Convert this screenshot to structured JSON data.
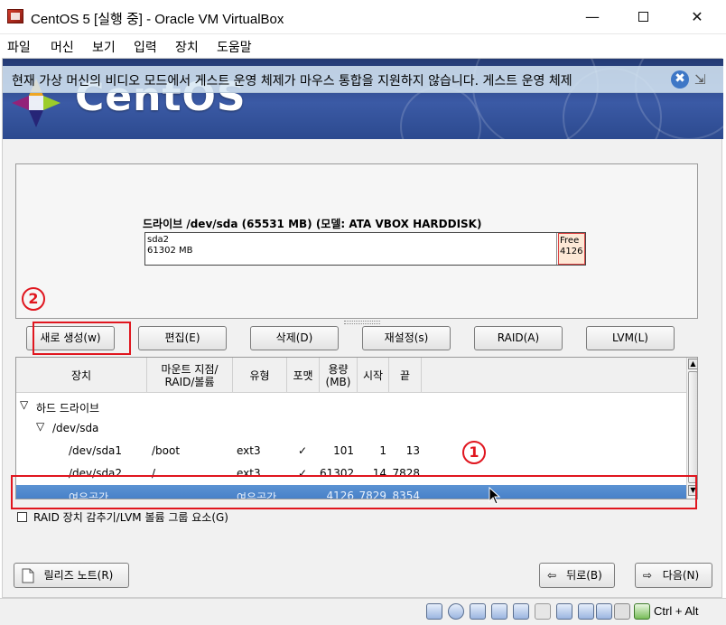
{
  "window": {
    "title": "CentOS 5 [실행 중] - Oracle VM VirtualBox",
    "min_glyph": "—",
    "close_glyph": "✕"
  },
  "menu": [
    "파일",
    "머신",
    "보기",
    "입력",
    "장치",
    "도움말"
  ],
  "banner": {
    "logo_text": "CentOS",
    "notice": "현재 가상 머신의 비디오 모드에서 게스트 운영 체제가 마우스 통합을 지원하지 않습니다. 게스트 운영 체제",
    "notice_close": "✖",
    "notice_arrow": "⇲"
  },
  "disk": {
    "drive_label": "드라이브  /dev/sda (65531 MB) (모델:  ATA VBOX HARDDISK)",
    "seg_main_name": "sda2",
    "seg_main_size": "61302 MB",
    "seg_free_name": "Free",
    "seg_free_size": "4126"
  },
  "buttons": {
    "new": "새로 생성(w)",
    "edit": "편집(E)",
    "delete": "삭제(D)",
    "reset": "재설정(s)",
    "raid": "RAID(A)",
    "lvm": "LVM(L)"
  },
  "annotations": {
    "one": "1",
    "two": "2"
  },
  "table": {
    "headers": {
      "device": "장치",
      "mount": "마운트 지점/ RAID/볼륨",
      "type": "유형",
      "format": "포맷",
      "size": "용량 (MB)",
      "start": "시작",
      "end": "끝"
    },
    "group_hd": "하드 드라이브",
    "group_sda": "/dev/sda",
    "rows": [
      {
        "device": "/dev/sda1",
        "mount": "/boot",
        "type": "ext3",
        "format": "✓",
        "size": "101",
        "start": "1",
        "end": "13"
      },
      {
        "device": "/dev/sda2",
        "mount": "/",
        "type": "ext3",
        "format": "✓",
        "size": "61302",
        "start": "14",
        "end": "7828"
      },
      {
        "device": "여유공간",
        "mount": "",
        "type": "여유공간",
        "format": "",
        "size": "4126",
        "start": "7829",
        "end": "8354"
      }
    ]
  },
  "raid_checkbox_label": "RAID 장치 감추기/LVM 볼륨 그룹 요소(G)",
  "nav": {
    "release_notes": "릴리즈 노트(R)",
    "back": "뒤로(B)",
    "next": "다음(N)"
  },
  "status": {
    "host_key": "Ctrl + Alt"
  }
}
